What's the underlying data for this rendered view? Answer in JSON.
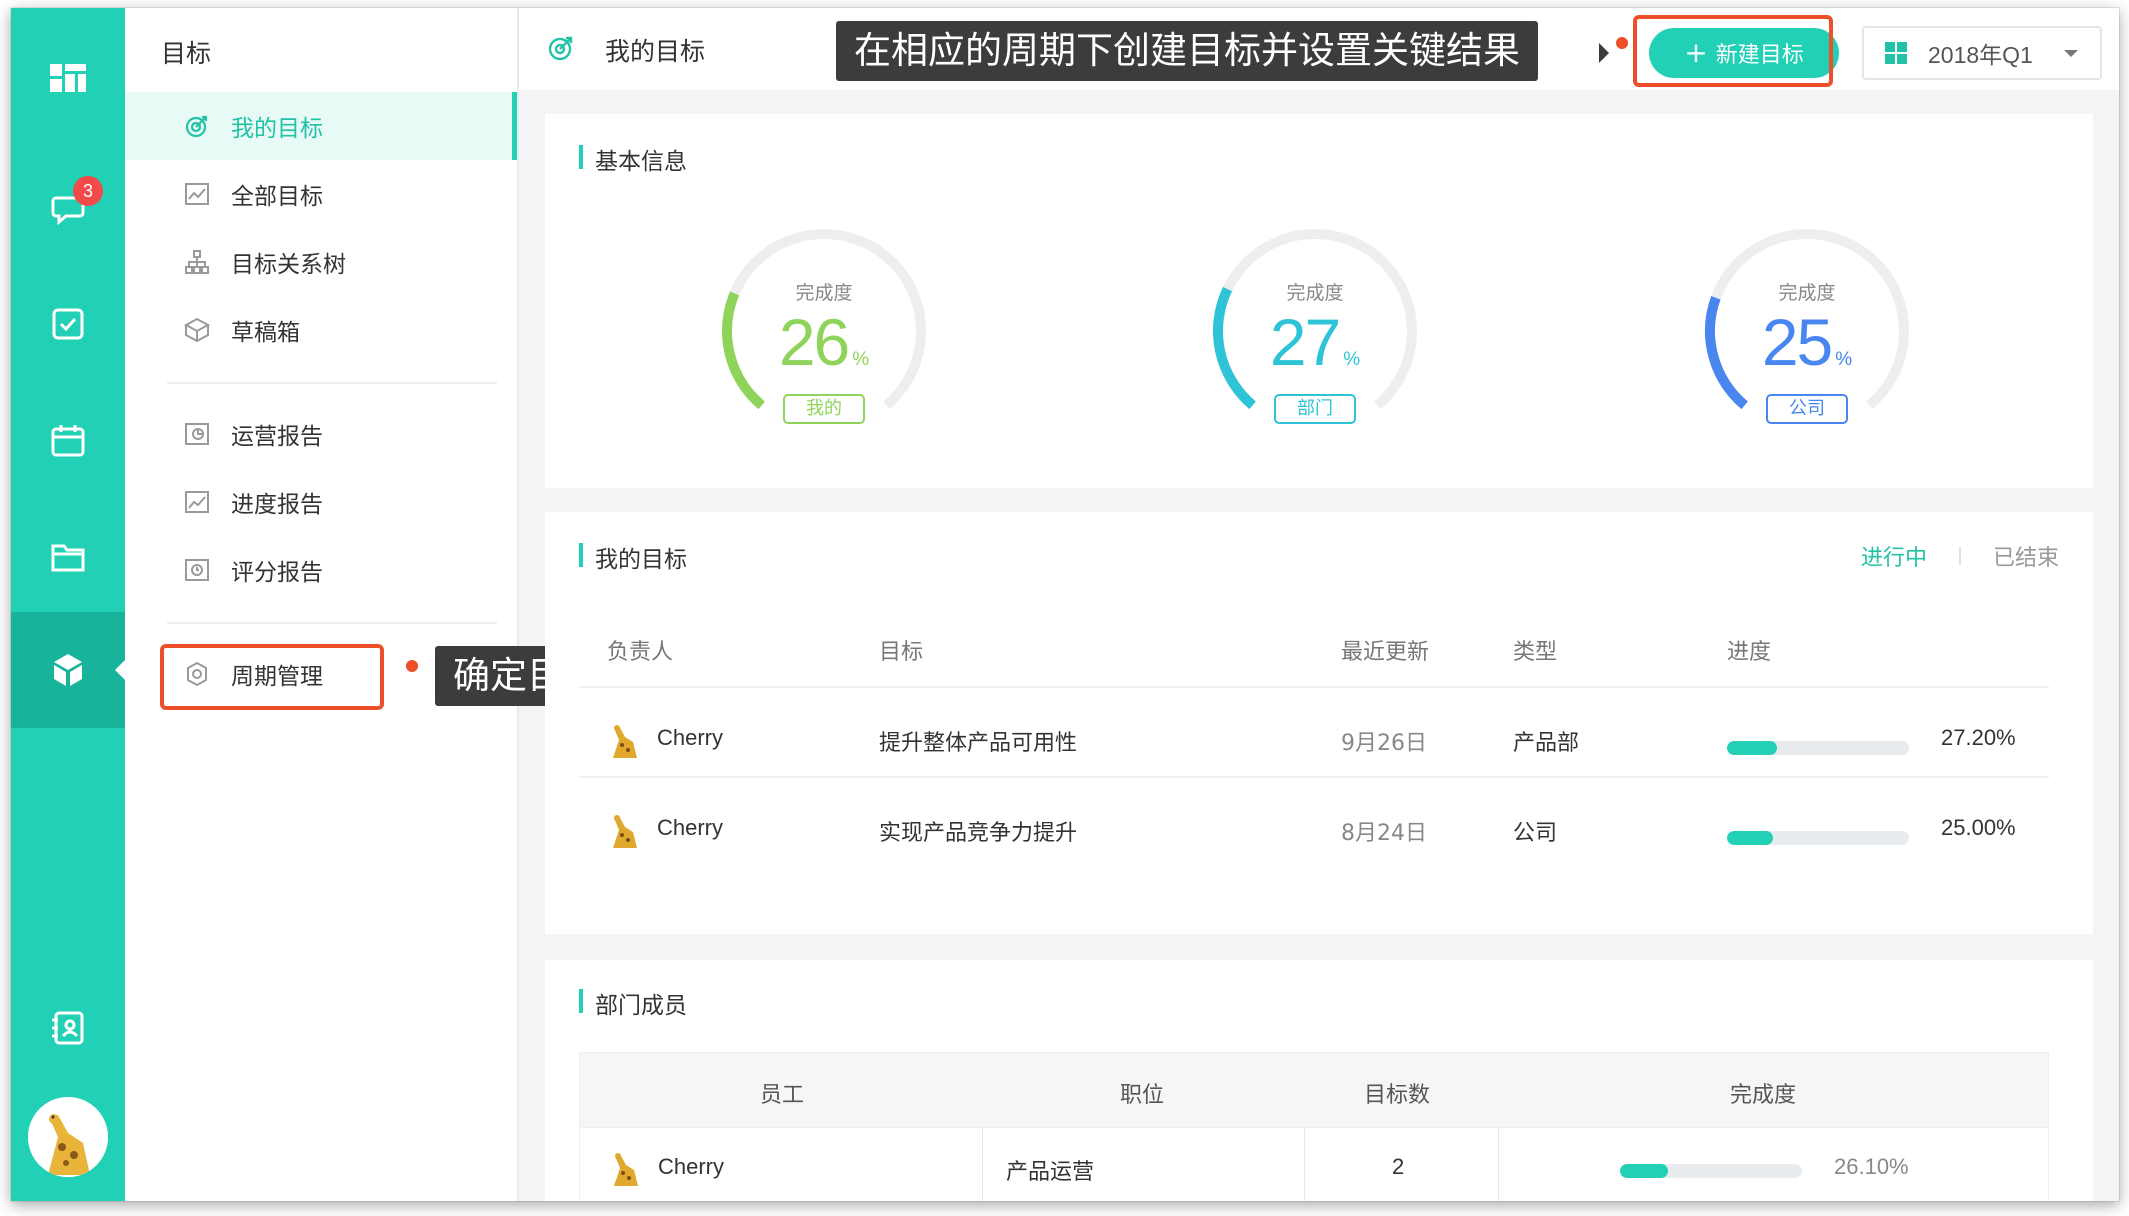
{
  "rail": {
    "notification_count": "3"
  },
  "nav": {
    "title": "目标",
    "items": [
      {
        "label": "我的目标"
      },
      {
        "label": "全部目标"
      },
      {
        "label": "目标关系树"
      },
      {
        "label": "草稿箱"
      },
      {
        "label": "运营报告"
      },
      {
        "label": "进度报告"
      },
      {
        "label": "评分报告"
      },
      {
        "label": "周期管理"
      }
    ]
  },
  "callouts": {
    "cycle": "确定目标管理的周期",
    "create": "在相应的周期下创建目标并设置关键结果"
  },
  "header": {
    "title": "我的目标",
    "new_button": "新建目标",
    "period": "2018年Q1"
  },
  "basic_info": {
    "title": "基本信息",
    "gauges": [
      {
        "label": "完成度",
        "value": "26",
        "unit": "%",
        "tag": "我的",
        "percent": 26,
        "color": "#8fd45a"
      },
      {
        "label": "完成度",
        "value": "27",
        "unit": "%",
        "tag": "部门",
        "percent": 27,
        "color": "#2ec3d6"
      },
      {
        "label": "完成度",
        "value": "25",
        "unit": "%",
        "tag": "公司",
        "percent": 25,
        "color": "#4a86f0"
      }
    ]
  },
  "my_goals": {
    "title": "我的目标",
    "tab_active": "进行中",
    "tab_inactive": "已结束",
    "columns": [
      "负责人",
      "目标",
      "最近更新",
      "类型",
      "进度"
    ],
    "rows": [
      {
        "owner": "Cherry",
        "goal": "提升整体产品可用性",
        "updated": "9月26日",
        "type": "产品部",
        "progress": "27.20%",
        "fraction": 0.272
      },
      {
        "owner": "Cherry",
        "goal": "实现产品竞争力提升",
        "updated": "8月24日",
        "type": "公司",
        "progress": "25.00%",
        "fraction": 0.25
      }
    ]
  },
  "members": {
    "title": "部门成员",
    "columns": [
      "员工",
      "职位",
      "目标数",
      "完成度"
    ],
    "rows": [
      {
        "name": "Cherry",
        "position": "产品运营",
        "goal_count": "2",
        "completion": "26.10%",
        "fraction": 0.261
      }
    ]
  },
  "colors": {
    "accent": "#22d0b5",
    "highlight": "#ec4f2a"
  }
}
